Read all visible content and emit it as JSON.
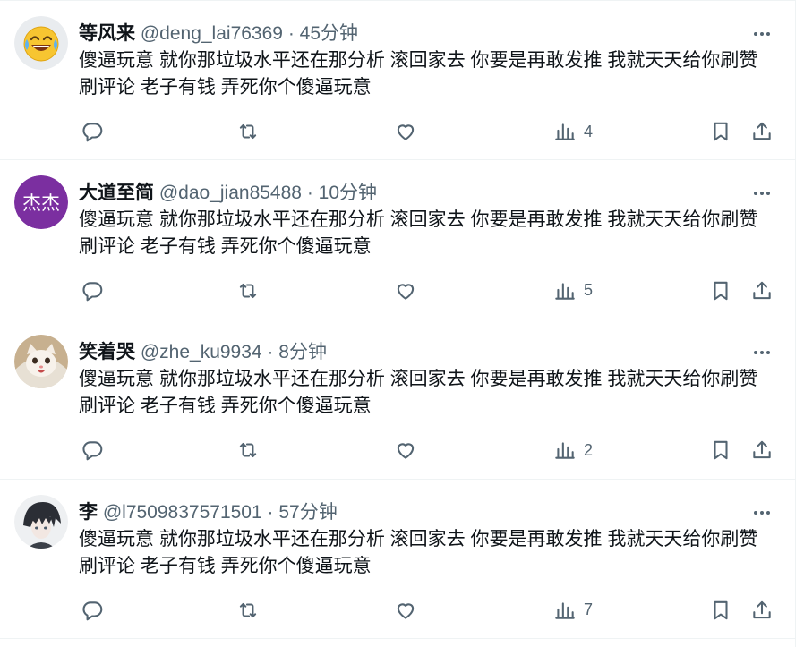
{
  "tweets": [
    {
      "name": "等风来",
      "handle": "@deng_lai76369",
      "separator": "·",
      "time": "45分钟",
      "text": "傻逼玩意 就你那垃圾水平还在那分析 滚回家去 你要是再敢发推 我就天天给你刷赞 刷评论 老子有钱 弄死你个傻逼玩意",
      "views": "4",
      "avatar": "laughing-emoji"
    },
    {
      "name": "大道至简",
      "handle": "@dao_jian85488",
      "separator": "·",
      "time": "10分钟",
      "text": "傻逼玩意 就你那垃圾水平还在那分析 滚回家去 你要是再敢发推 我就天天给你刷赞 刷评论 老子有钱 弄死你个傻逼玩意",
      "views": "5",
      "avatar": "text-avatar",
      "avatar_text": "杰杰",
      "avatar_color": "#7b2fa0"
    },
    {
      "name": "笑着哭",
      "handle": "@zhe_ku9934",
      "separator": "·",
      "time": "8分钟",
      "text": "傻逼玩意 就你那垃圾水平还在那分析 滚回家去 你要是再敢发推 我就天天给你刷赞 刷评论 老子有钱 弄死你个傻逼玩意",
      "views": "2",
      "avatar": "cat-photo"
    },
    {
      "name": "李",
      "handle": "@l7509837571501",
      "separator": "·",
      "time": "57分钟",
      "text": "傻逼玩意 就你那垃圾水平还在那分析 滚回家去 你要是再敢发推 我就天天给你刷赞 刷评论 老子有钱 弄死你个傻逼玩意",
      "views": "7",
      "avatar": "anime-character"
    }
  ],
  "icons": {
    "more": "more-horizontal-icon",
    "reply": "reply-icon",
    "retweet": "retweet-icon",
    "like": "heart-icon",
    "views": "views-chart-icon",
    "bookmark": "bookmark-icon",
    "share": "share-icon"
  },
  "colors": {
    "text": "#0f1419",
    "secondary": "#536471",
    "border": "#eff3f4"
  }
}
